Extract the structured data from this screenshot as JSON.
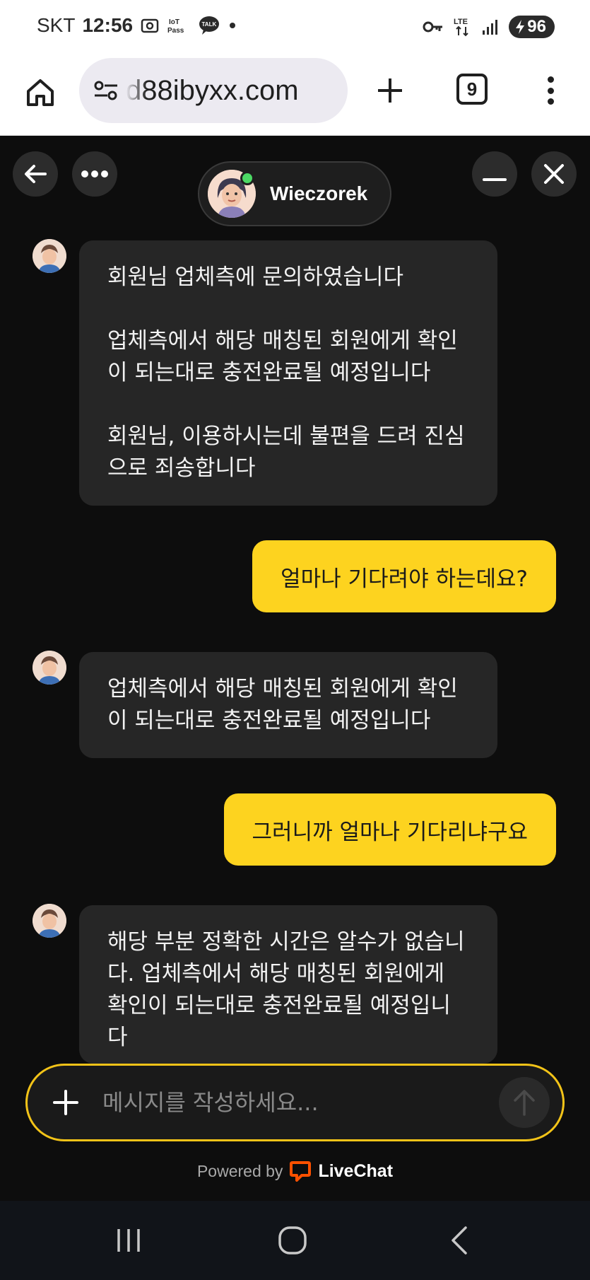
{
  "status_bar": {
    "carrier": "SKT",
    "time": "12:56",
    "battery": "96",
    "network": "LTE"
  },
  "browser": {
    "url": "d88ibyxx.com",
    "tab_count": "9"
  },
  "chat": {
    "agent_name": "Wieczorek",
    "messages": [
      {
        "from": "agent",
        "text": "회원님 업체측에 문의하였습니다\n\n업체측에서 해당 매칭된 회원에게 확인이 되는대로 충전완료될 예정입니다\n\n회원님, 이용하시는데 불편을 드려 진심으로 죄송합니다"
      },
      {
        "from": "user",
        "text": "얼마나 기다려야 하는데요?"
      },
      {
        "from": "agent",
        "text": "업체측에서 해당 매칭된 회원에게 확인이 되는대로 충전완료될 예정입니다"
      },
      {
        "from": "user",
        "text": "그러니까 얼마나 기다리냐구요"
      },
      {
        "from": "agent",
        "text": "해당 부분 정확한 시간은 알수가 없습니다. 업체측에서 해당 매칭된 회원에게 확인이 되는대로 충전완료될 예정입니다"
      }
    ]
  },
  "composer": {
    "placeholder": "메시지를 작성하세요..."
  },
  "footer": {
    "powered_by": "Powered by",
    "brand": "LiveChat"
  },
  "colors": {
    "accent": "#fdd31f",
    "background": "#0d0d0d",
    "agent_bubble": "#262626",
    "online": "#4cd964",
    "livechat_brand": "#ff5100"
  }
}
